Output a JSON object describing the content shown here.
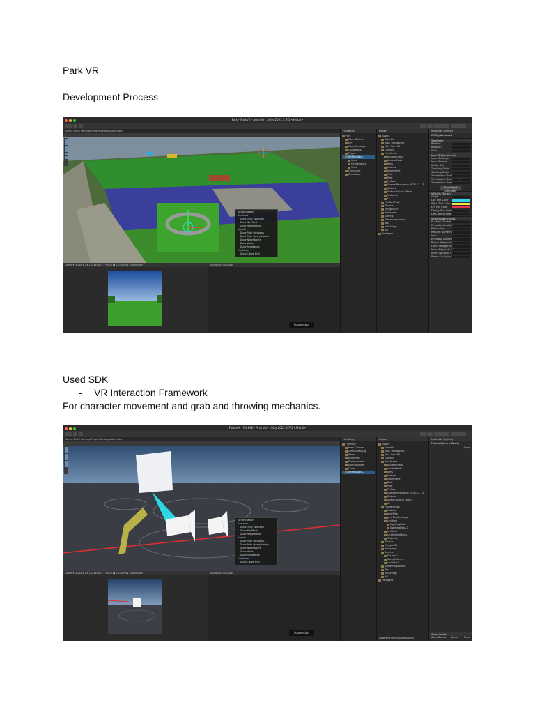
{
  "document": {
    "title": "Park VR",
    "section_heading": "Development Process",
    "sdk_heading": "Used SDK",
    "sdk_items": [
      {
        "bullet": "-",
        "label": "VR Interaction Framework"
      }
    ],
    "purpose": "For character movement and grab and throwing mechanics."
  },
  "screenshot_1": {
    "window_title": "Park - ParkVR - Android - Unity 2022.3.7f1 <Metal>",
    "scene_tabs": "Scene   Build Settings   Project Settings   Animator",
    "game_tab": "Game",
    "game_bar": "Game  ▾  Display 1 ▾  1024x1024  ▾  Scale ● 0.23x  Play Maximized ▾",
    "animation_tabs": "Animation   Console",
    "screenshot_button": "Screenshot",
    "hierarchy_tab": "Hierarchy",
    "hierarchy_items": [
      {
        "label": "Park",
        "level": 0,
        "selected": false
      },
      {
        "label": "EventSystem",
        "level": 1,
        "selected": false
      },
      {
        "label": "Env",
        "level": 1,
        "selected": false
      },
      {
        "label": "GameManager",
        "level": 1,
        "selected": false
      },
      {
        "label": "Conditions",
        "level": 1,
        "selected": false
      },
      {
        "label": "Player",
        "level": 1,
        "selected": false
      },
      {
        "label": "XR Rig Adv...",
        "level": 1,
        "selected": true
      },
      {
        "label": "Cars",
        "level": 2,
        "selected": false
      },
      {
        "label": "Checkpoints",
        "level": 2,
        "selected": false
      },
      {
        "label": "Start",
        "level": 2,
        "selected": false
      },
      {
        "label": "Character",
        "level": 1,
        "selected": false
      },
      {
        "label": "Recorders",
        "level": 1,
        "selected": false
      }
    ],
    "project_tab": "Project",
    "project_items": [
      {
        "label": "Assets",
        "level": 0
      },
      {
        "label": "Addrsbl",
        "level": 1
      },
      {
        "label": "BNG Framework",
        "level": 1
      },
      {
        "label": "Epic Toon FX",
        "level": 1
      },
      {
        "label": "Gizmos",
        "level": 1
      },
      {
        "label": "ParkScene",
        "level": 1
      },
      {
        "label": "Appear.mats",
        "level": 2
      },
      {
        "label": "AppearMats",
        "level": 2
      },
      {
        "label": "Nets",
        "level": 2
      },
      {
        "label": "Models",
        "level": 2
      },
      {
        "label": "Movement",
        "level": 2
      },
      {
        "label": "Park 1",
        "level": 2
      },
      {
        "label": "Park",
        "level": 2
      },
      {
        "label": "Prefabs",
        "level": 2
      },
      {
        "label": "Screen Recording 2023-12-13",
        "level": 2
      },
      {
        "label": "Scripts",
        "level": 2
      },
      {
        "label": "Splash Sound Effect",
        "level": 2
      },
      {
        "label": "Textures",
        "level": 2
      },
      {
        "label": "UI",
        "level": 2
      },
      {
        "label": "PinkBellPack",
        "level": 1
      },
      {
        "label": "Plugins",
        "level": 1
      },
      {
        "label": "PolygonCity",
        "level": 1
      },
      {
        "label": "Resources",
        "level": 1
      },
      {
        "label": "Scenes",
        "level": 1
      },
      {
        "label": "StreamingAssets",
        "level": 1
      },
      {
        "label": "Text",
        "level": 1
      },
      {
        "label": "xrSettings",
        "level": 1
      },
      {
        "label": "XR",
        "level": 1
      },
      {
        "label": "Packages",
        "level": 0
      }
    ],
    "inspector_tabs": "Inspector   Lighting",
    "inspector_object": "XR Rig Advanced",
    "inspector_sections": [
      {
        "header": "Transform",
        "rows": [
          "Position",
          "Rotation",
          "Scale"
        ]
      },
      {
        "header": "Input Bridge (Script)",
        "rows": [
          "Input Settings",
          "Input Source",
          "Action Set",
          "Tracking Origin",
          "Tracking Origin",
          "Thumbstick Deadzone",
          "Thumbstick Deadzone X",
          "Thumbstick Deadzone Y"
        ]
      },
      {
        "header": "VR Utils (Script)",
        "rows": [
          "Script",
          "Log Text Color",
          "Warn Text Color",
          "Err Text Color",
          "Debug Text Holder",
          "Last Debug Msg"
        ]
      },
      {
        "header": "VR Emulator (Script)",
        "rows": [
          "Enable / Disable",
          "Emulator Enabled",
          "Editor Only",
          "Require Game Focus",
          "Input",
          "Emulator Action Ma",
          "Player Teleportation",
          "Force Straight Teleport Rotation",
          "Move Player Up / Down",
          "Allow Up Down Controls",
          "Player Up Action"
        ]
      }
    ],
    "inspector_button": "Show Input Debugger",
    "overlay": {
      "title": "AI Navigation",
      "groups": [
        {
          "header": "Surfaces",
          "items": [
            "Show Only Selected",
            "Show NavMesh",
            "Show HeightMesh"
          ]
        },
        {
          "header": "Agents",
          "items": [
            "Show Path Polygons",
            "Show Path Query Nodes",
            "Show Neighbours",
            "Show Walls",
            "Show Avoidance"
          ]
        },
        {
          "header": "Obstacles",
          "items": [
            "Show Carve Hull"
          ]
        }
      ]
    }
  },
  "screenshot_2": {
    "window_title": "FutureAI - ParkVR - Android - Unity 2022.3.7f1 <Metal>",
    "scene_tabs": "Scene   Build Settings   Project Settings   Animator",
    "game_bar": "Game  ▾  Display 1 ▾  1024x1024  ▾  Scale ● 0.23x  Play Maximized ▾",
    "animation_tabs": "Animation   Console",
    "screenshot_button": "Screenshot",
    "hierarchy_tab": "Hierarchy",
    "hierarchy_items": [
      {
        "label": "FutureAI",
        "level": 0,
        "selected": false
      },
      {
        "label": "Main Camera",
        "level": 1,
        "selected": false
      },
      {
        "label": "Directional Lig",
        "level": 1,
        "selected": false
      },
      {
        "label": "Items",
        "level": 1,
        "selected": false
      },
      {
        "label": "RightPlan",
        "level": 1,
        "selected": false
      },
      {
        "label": "Environment",
        "level": 1,
        "selected": false
      },
      {
        "label": "EventSystem",
        "level": 1,
        "selected": false
      },
      {
        "label": "Cube",
        "level": 1,
        "selected": false
      },
      {
        "label": "XR Rig Adv...",
        "level": 1,
        "selected": true
      }
    ],
    "project_tab": "Project",
    "project_items": [
      {
        "label": "Assets",
        "level": 0
      },
      {
        "label": "Addrsbl",
        "level": 1
      },
      {
        "label": "BNG Framework",
        "level": 1
      },
      {
        "label": "Epic Toon FX",
        "level": 1
      },
      {
        "label": "Gizmos",
        "level": 1
      },
      {
        "label": "ParkScene",
        "level": 1
      },
      {
        "label": "Appear.mats",
        "level": 2
      },
      {
        "label": "AppearMats",
        "level": 2
      },
      {
        "label": "Nets",
        "level": 2
      },
      {
        "label": "Models",
        "level": 2
      },
      {
        "label": "Movement",
        "level": 2
      },
      {
        "label": "Park 1",
        "level": 2
      },
      {
        "label": "Park",
        "level": 2
      },
      {
        "label": "Prefabs",
        "level": 2
      },
      {
        "label": "Screen Recording 2023-12-13",
        "level": 2
      },
      {
        "label": "Scripts",
        "level": 2
      },
      {
        "label": "Splash Sound Effect",
        "level": 2
      },
      {
        "label": "UI",
        "level": 2
      },
      {
        "label": "PinkBellPack",
        "level": 1
      },
      {
        "label": "Models",
        "level": 2
      },
      {
        "label": "pinePlan",
        "level": 2
      },
      {
        "label": "pinePlanSettings",
        "level": 2
      },
      {
        "label": "Untitled",
        "level": 2
      },
      {
        "label": "LightingData",
        "level": 3
      },
      {
        "label": "LightingData-1",
        "level": 3
      },
      {
        "label": "Untitled",
        "level": 2
      },
      {
        "label": "UntitledSettings",
        "level": 2
      },
      {
        "label": "Textures",
        "level": 2
      },
      {
        "label": "Plugins",
        "level": 1
      },
      {
        "label": "PolygonCity",
        "level": 1
      },
      {
        "label": "Resources",
        "level": 1
      },
      {
        "label": "Scenes",
        "level": 1
      },
      {
        "label": "FutureAI",
        "level": 2
      },
      {
        "label": "SampleScene",
        "level": 2
      },
      {
        "label": "Untitled 1",
        "level": 2
      },
      {
        "label": "StreamingAssets",
        "level": 1
      },
      {
        "label": "Text",
        "level": 1
      },
      {
        "label": "xrSettings",
        "level": 1
      },
      {
        "label": "XR",
        "level": 1
      },
      {
        "label": "Packages",
        "level": 0
      }
    ],
    "project_footer": "Assets/Scenes/FutureAI.unity",
    "inspector_tabs": "Inspector   Lighting",
    "inspector_object": "FutureAI (Scene Asset)",
    "inspector_open": "Open",
    "asset_labels": "Asset Labels",
    "asset_bundle_label": "AssetBundle",
    "asset_bundle_value": "None",
    "asset_bundle_value2": "None",
    "overlay": {
      "title": "AI Navigation",
      "groups": [
        {
          "header": "Surfaces",
          "items": [
            "Show Only Selected",
            "Show NavMesh",
            "Show HeightMesh"
          ]
        },
        {
          "header": "Agents",
          "items": [
            "Show Path Polygons",
            "Show Path Query Nodes",
            "Show Neighbours",
            "Show Walls",
            "Show Avoidance"
          ]
        },
        {
          "header": "Obstacles",
          "items": [
            "Show Carve Hull"
          ]
        }
      ]
    }
  },
  "colors": {
    "selection": "#2c5d87",
    "log_text": "#33d6e8",
    "warn_text": "#f2e64a",
    "error_text": "#e8344a"
  }
}
